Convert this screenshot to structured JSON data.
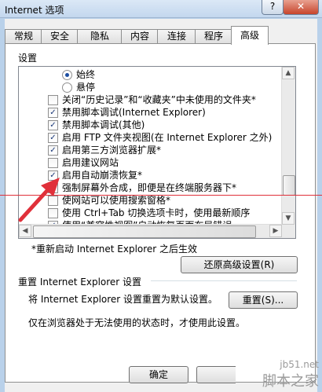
{
  "window": {
    "title": "Internet 选项",
    "help_label": "?",
    "close_label": "✕"
  },
  "tabs": [
    "常规",
    "安全",
    "隐私",
    "内容",
    "连接",
    "程序",
    "高级"
  ],
  "settings_label": "设置",
  "settings": [
    {
      "type": "radio",
      "checked": true,
      "text": "始终"
    },
    {
      "type": "radio",
      "checked": false,
      "text": "悬停"
    },
    {
      "type": "checkbox",
      "checked": false,
      "text": "关闭“历史记录”和“收藏夹”中未使用的文件夹*"
    },
    {
      "type": "checkbox",
      "checked": true,
      "text": "禁用脚本调试(Internet Explorer)"
    },
    {
      "type": "checkbox",
      "checked": true,
      "text": "禁用脚本调试(其他)"
    },
    {
      "type": "checkbox",
      "checked": true,
      "text": "启用 FTP 文件夹视图(在 Internet Explorer 之外)"
    },
    {
      "type": "checkbox",
      "checked": true,
      "text": "启用第三方浏览器扩展*"
    },
    {
      "type": "checkbox",
      "checked": false,
      "text": "启用建议网站"
    },
    {
      "type": "checkbox",
      "checked": true,
      "text": "启用自动崩溃恢复*"
    },
    {
      "type": "checkbox",
      "checked": false,
      "text": "强制屏幕外合成，即便是在终端服务器下*"
    },
    {
      "type": "checkbox",
      "checked": false,
      "text": "使网站可以使用搜索窗格*"
    },
    {
      "type": "checkbox",
      "checked": false,
      "text": "使用 Ctrl+Tab 切换选项卡时，使用最新顺序"
    },
    {
      "type": "checkbox",
      "checked": true,
      "text": "使用“兼容性视图”自动恢复页面布局错误"
    }
  ],
  "restart_note": "*重新启动 Internet Explorer 之后生效",
  "restore_advanced_button": "还原高级设置(R)",
  "reset_section_label": "重置 Internet Explorer 设置",
  "reset_description": "将 Internet Explorer 设置重置为默认设置。",
  "reset_button": "重置(S)...",
  "reset_warning": "仅在浏览器处于无法使用的状态时，才使用此设置。",
  "ok_button": "确定",
  "watermark": {
    "site": "jb51.net",
    "name": "脚本之家"
  },
  "colors": {
    "arrow": "#e0303a",
    "check": "#1c3a7a",
    "radio": "#1d4ea2"
  }
}
